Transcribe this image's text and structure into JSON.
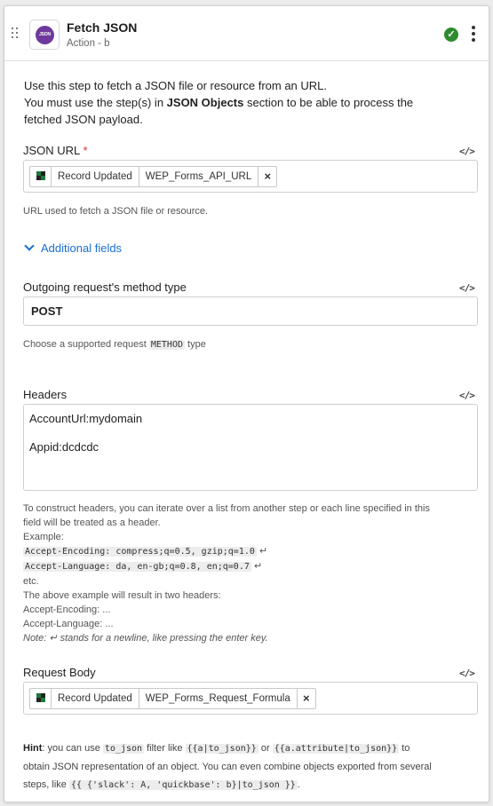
{
  "header": {
    "title": "Fetch JSON",
    "subtitle": "Action - b",
    "app_icon_text": "JSON",
    "status_color": "#2e8b2e"
  },
  "intro": {
    "line1": "Use this step to fetch a JSON file or resource from an URL.",
    "line2_pre": "You must use the step(s) in ",
    "line2_bold": "JSON Objects",
    "line2_post": " section to be able to process the",
    "line3": "fetched JSON payload."
  },
  "json_url": {
    "label": "JSON URL",
    "required_mark": "*",
    "pill_source": "Record Updated",
    "pill_field": "WEP_Forms_API_URL",
    "remove_glyph": "×",
    "help": "URL used to fetch a JSON file or resource."
  },
  "additional_fields": {
    "label": "Additional fields"
  },
  "method": {
    "label": "Outgoing request's method type",
    "value": "POST",
    "help_pre": "Choose a supported request ",
    "help_code": "METHOD",
    "help_post": " type"
  },
  "headers": {
    "label": "Headers",
    "line1": "AccountUrl:mydomain",
    "line2": "Appid:dcdcdc",
    "help": {
      "line1": "To construct headers, you can iterate over a list from another step or each line specified in this",
      "line2": "field will be treated as a header.",
      "example_label": "Example:",
      "example1": "Accept-Encoding: compress;q=0.5, gzip;q=1.0",
      "example2": "Accept-Language: da, en-gb;q=0.8, en;q=0.7",
      "newline_glyph": "↵",
      "etc": "etc.",
      "result": "The above example will result in two headers:",
      "result1": "Accept-Encoding: ...",
      "result2": "Accept-Language: ...",
      "note": "Note: ↵ stands for a newline, like pressing the enter key."
    }
  },
  "request_body": {
    "label": "Request Body",
    "pill_source": "Record Updated",
    "pill_field": "WEP_Forms_Request_Formula",
    "remove_glyph": "×"
  },
  "hint": {
    "bold": "Hint",
    "t1": ": you can use ",
    "c1": "to_json",
    "t2": " filter like ",
    "c2": "{{a|to_json}}",
    "t3": " or ",
    "c3": "{{a.attribute|to_json}}",
    "t4": " to",
    "t5": "obtain JSON representation of an object. You can even combine objects exported from several",
    "t6": "steps, like ",
    "c4": "{{ {'slack': A, 'quickbase': b}|to_json }}",
    "t7": "."
  },
  "code_toggle_glyph": "</>",
  "colors": {
    "link": "#1a6fd1",
    "required": "#d13030",
    "app_icon": "#6d3a9c"
  }
}
